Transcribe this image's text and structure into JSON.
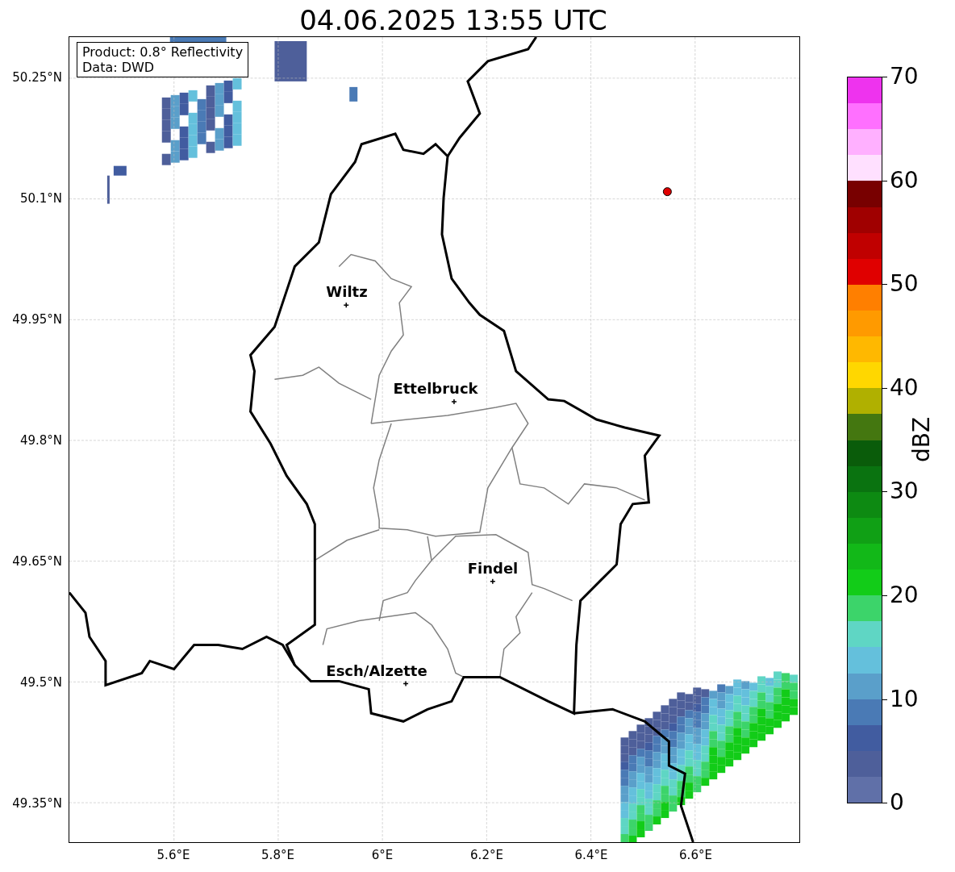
{
  "title": "04.06.2025 13:55 UTC",
  "legend": [
    "Product: 0.8° Reflectivity",
    "Data: DWD"
  ],
  "y_ticks": [
    "50.25°N",
    "50.1°N",
    "49.95°N",
    "49.8°N",
    "49.65°N",
    "49.5°N",
    "49.35°N"
  ],
  "x_ticks": [
    "5.6°E",
    "5.8°E",
    "6°E",
    "6.2°E",
    "6.4°E",
    "6.6°E"
  ],
  "cities": [
    {
      "name": "Wiltz"
    },
    {
      "name": "Ettelbruck"
    },
    {
      "name": "Findel"
    },
    {
      "name": "Esch/Alzette"
    }
  ],
  "colorbar": {
    "label": "dBZ",
    "ticks": [
      "70",
      "60",
      "50",
      "40",
      "30",
      "20",
      "10",
      "0"
    ],
    "segments": [
      {
        "color": "#ee33ee"
      },
      {
        "color": "#ff70ff"
      },
      {
        "color": "#ffb0ff"
      },
      {
        "color": "#ffe0ff"
      },
      {
        "color": "#780000"
      },
      {
        "color": "#a00000"
      },
      {
        "color": "#c00000"
      },
      {
        "color": "#e00000"
      },
      {
        "color": "#ff7f00"
      },
      {
        "color": "#ff9a00"
      },
      {
        "color": "#ffb800"
      },
      {
        "color": "#ffd700"
      },
      {
        "color": "#b0b000"
      },
      {
        "color": "#447710"
      },
      {
        "color": "#0a5c0a"
      },
      {
        "color": "#0a7310"
      },
      {
        "color": "#0d8a12"
      },
      {
        "color": "#10a015"
      },
      {
        "color": "#12b818"
      },
      {
        "color": "#12cc18"
      },
      {
        "color": "#3cd46a"
      },
      {
        "color": "#5fd6c4"
      },
      {
        "color": "#64c0dc"
      },
      {
        "color": "#5a9fca"
      },
      {
        "color": "#4a7ab5"
      },
      {
        "color": "#415ca0"
      },
      {
        "color": "#4e5f9a"
      },
      {
        "color": "#6070a8"
      }
    ]
  }
}
